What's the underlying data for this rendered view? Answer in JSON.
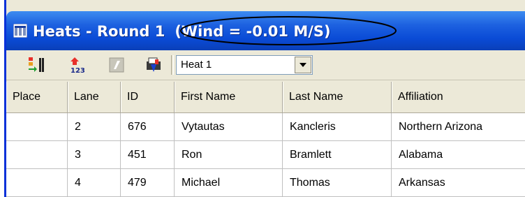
{
  "window": {
    "title": "Heats - Round 1",
    "wind_label": "(Wind = -0.01 M/S)",
    "colors": {
      "titlebar": "#0a4bd6",
      "title_text": "#ffffff",
      "window_face": "#ece9d8"
    }
  },
  "toolbar": {
    "buttons": [
      {
        "icon": "lane-assign-icon"
      },
      {
        "icon": "sort-numeric-icon"
      },
      {
        "icon": "edit-disabled-icon"
      },
      {
        "icon": "print-icon"
      }
    ],
    "heat_select": {
      "value": "Heat 1"
    }
  },
  "grid": {
    "columns": [
      "Place",
      "Lane",
      "ID",
      "First Name",
      "Last Name",
      "Affiliation"
    ],
    "rows": [
      {
        "place": "",
        "lane": "2",
        "id": "676",
        "first": "Vytautas",
        "last": "Kancleris",
        "affiliation": "Northern Arizona"
      },
      {
        "place": "",
        "lane": "3",
        "id": "451",
        "first": "Ron",
        "last": "Bramlett",
        "affiliation": "Alabama"
      },
      {
        "place": "",
        "lane": "4",
        "id": "479",
        "first": "Michael",
        "last": "Thomas",
        "affiliation": "Arkansas"
      }
    ]
  }
}
